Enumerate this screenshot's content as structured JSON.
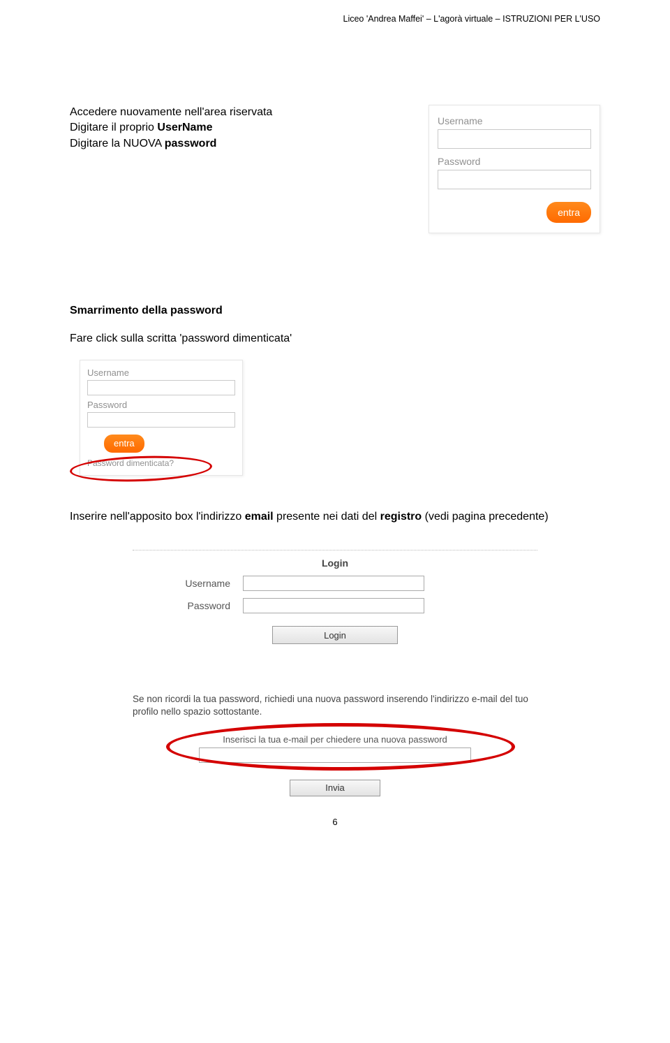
{
  "header": "Liceo 'Andrea Maffei' – L'agorà virtuale – ISTRUZIONI PER L'USO",
  "section1": {
    "line1": "Accedere nuovamente nell'area riservata",
    "line2a": "Digitare il proprio ",
    "line2b": "UserName",
    "line3a": "Digitare la NUOVA ",
    "line3b": "password"
  },
  "login1": {
    "username_label": "Username",
    "password_label": "Password",
    "button": "entra"
  },
  "section2": {
    "title": "Smarrimento della password",
    "click_text": "Fare click sulla scritta 'password dimenticata'"
  },
  "login2": {
    "username_label": "Username",
    "password_label": "Password",
    "button": "entra",
    "forgot": "Password dimenticata?"
  },
  "section3": {
    "a": "Inserire nell'apposito box l'indirizzo ",
    "b": "email",
    "c": " presente nei dati del ",
    "d": "registro",
    "e": " (vedi pagina precedente)"
  },
  "login_panel": {
    "title": "Login",
    "username_label": "Username",
    "password_label": "Password",
    "login_btn": "Login"
  },
  "recover": {
    "text": "Se non ricordi la tua password, richiedi una nuova password inserendo l'indirizzo e-mail del tuo profilo nello spazio sottostante.",
    "label": "Inserisci la tua e-mail per chiedere una nuova password",
    "button": "Invia"
  },
  "page_number": "6"
}
